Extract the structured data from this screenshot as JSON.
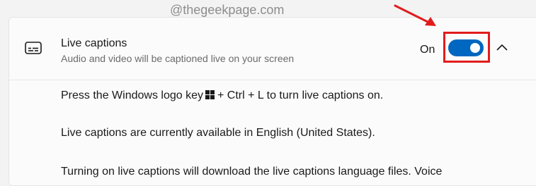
{
  "setting": {
    "title": "Live captions",
    "subtitle": "Audio and video will be captioned live on your screen",
    "toggle_state_label": "On",
    "toggle_on": true,
    "icon": "closed-captions-icon",
    "expand_icon": "chevron-up-icon"
  },
  "watermark": "@thegeekpage.com",
  "details": {
    "line1_before": "Press the Windows logo key",
    "line1_after": "+ Ctrl + L to turn live captions on.",
    "line2": "Live captions are currently available in English (United States).",
    "line3": "Turning on live captions will download the live captions language files. Voice"
  },
  "colors": {
    "accent": "#0067c0",
    "annotation": "#e21c1c"
  }
}
